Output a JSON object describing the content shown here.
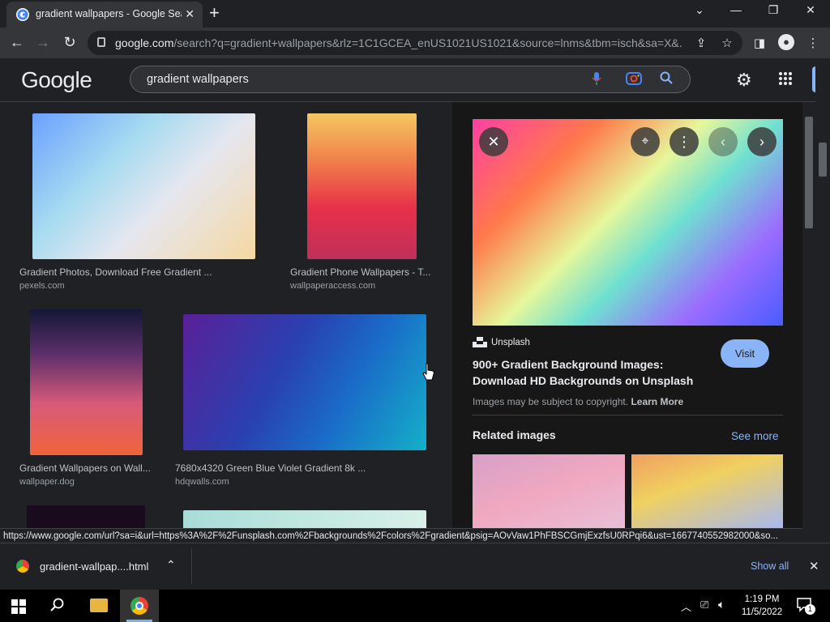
{
  "browser": {
    "tab_title": "gradient wallpapers - Google Sea",
    "url_domain": "google.com",
    "url_rest": "/search?q=gradient+wallpapers&rlz=1C1GCEA_enUS1021US1021&source=lnms&tbm=isch&sa=X&..."
  },
  "google": {
    "logo": "Google",
    "query": "gradient wallpapers"
  },
  "results": [
    {
      "caption": "Gradient Photos, Download Free Gradient ...",
      "source": "pexels.com"
    },
    {
      "caption": "Gradient Phone Wallpapers - T...",
      "source": "wallpaperaccess.com"
    },
    {
      "caption": "Gradient Wallpapers on Wall...",
      "source": "wallpaper.dog"
    },
    {
      "caption": "7680x4320 Green Blue Violet Gradient 8k ...",
      "source": "hdqwalls.com"
    }
  ],
  "preview": {
    "site": "Unsplash",
    "title": "900+ Gradient Background Images: Download HD Backgrounds on Unsplash",
    "visit_label": "Visit",
    "copyright": "Images may be subject to copyright.",
    "learn_more": "Learn More",
    "related_label": "Related images",
    "see_more": "See more"
  },
  "status_url": "https://www.google.com/url?sa=i&url=https%3A%2F%2Funsplash.com%2Fbackgrounds%2Fcolors%2Fgradient&psig=AOvVaw1PhFBSCGmjExzfsU0RPqi6&ust=1667740552982000&so...",
  "download": {
    "filename": "gradient-wallpap....html",
    "show_all": "Show all"
  },
  "taskbar": {
    "time": "1:19 PM",
    "date": "11/5/2022",
    "notification_count": "1"
  },
  "icons": {
    "back": "back-arrow-icon",
    "forward": "forward-arrow-icon",
    "reload": "reload-icon"
  }
}
